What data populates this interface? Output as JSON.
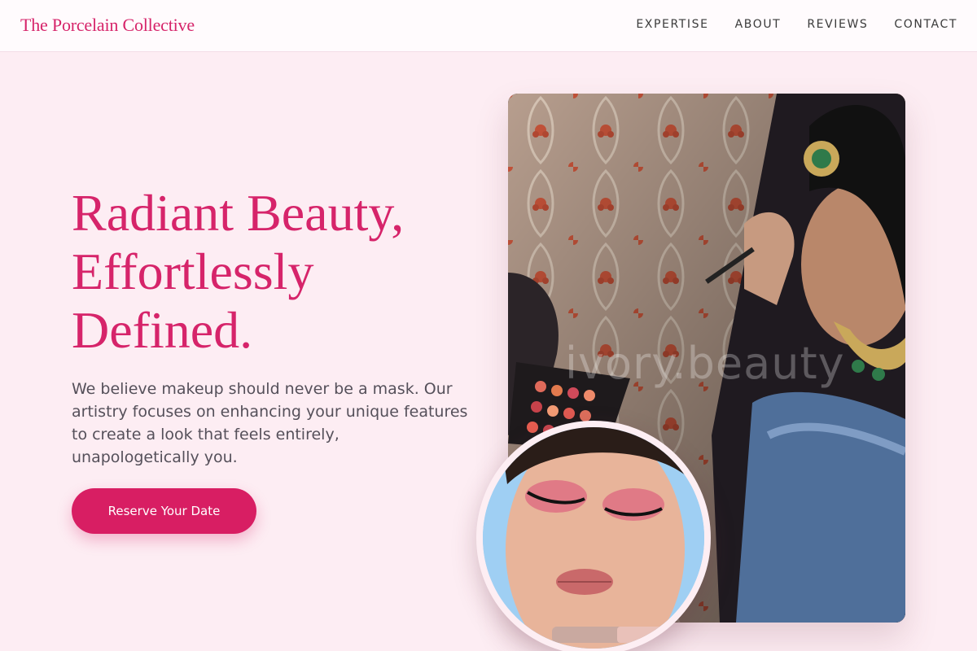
{
  "brand": {
    "name": "The Porcelain Collective"
  },
  "nav": {
    "items": [
      {
        "label": "EXPERTISE"
      },
      {
        "label": "ABOUT"
      },
      {
        "label": "REVIEWS"
      },
      {
        "label": "CONTACT"
      }
    ]
  },
  "hero": {
    "title_lines": [
      "Radiant Beauty,",
      "Effortlessly",
      "Defined."
    ],
    "body": "We believe makeup should never be a mask. Our artistry focuses on enhancing your unique features to create a look that feels entirely, unapologetically you.",
    "cta_label": "Reserve Your Date"
  },
  "media": {
    "main_photo_watermark": "ivory.beauty",
    "main_photo_icon": "makeup-artist-photo",
    "circle_photo_icon": "makeup-closeup-photo"
  },
  "colors": {
    "accent": "#d6246a",
    "button": "#d81e63",
    "background": "#fdedf3",
    "header_bg": "#fffbfd"
  }
}
